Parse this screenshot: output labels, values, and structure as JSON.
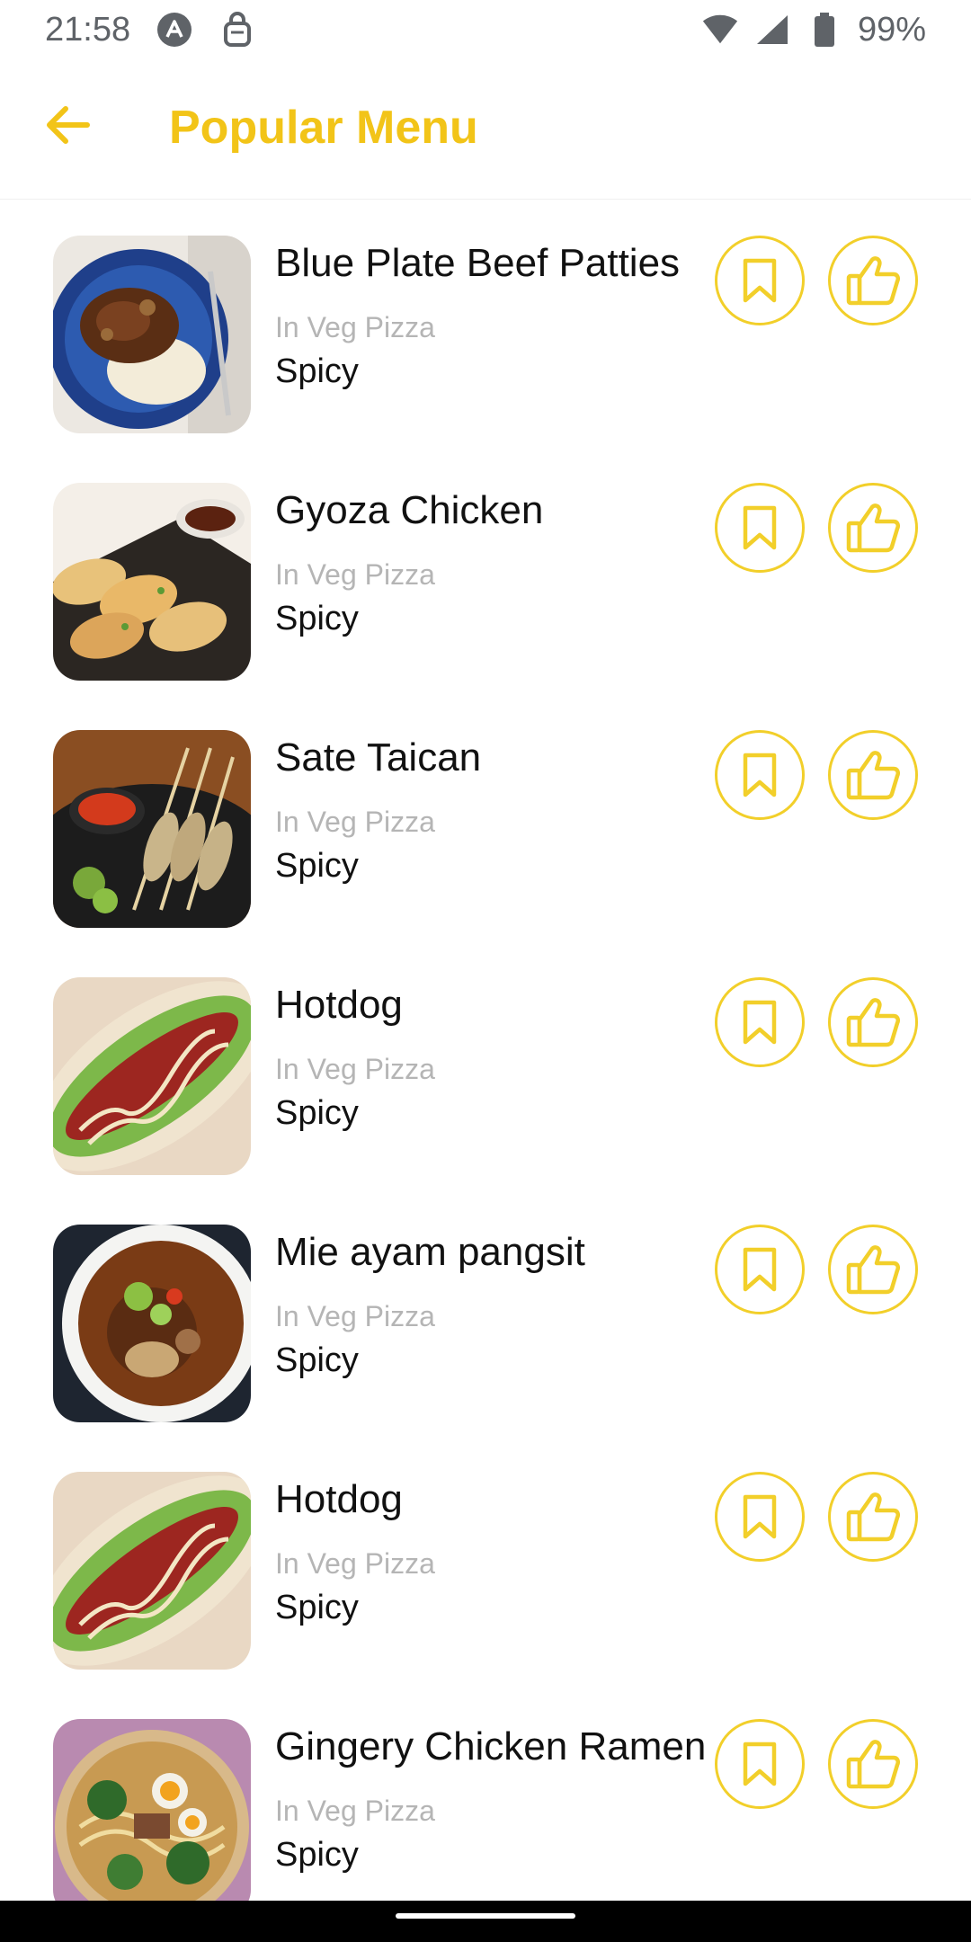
{
  "status_bar": {
    "time": "21:58",
    "battery": "99%"
  },
  "header": {
    "title": "Popular Menu",
    "back_icon": "arrow-left-icon"
  },
  "colors": {
    "accent": "#f2c418",
    "button_border": "#f2cf2a",
    "muted_text": "#b5b5b5"
  },
  "menu": {
    "items": [
      {
        "name": "Blue Plate Beef Patties",
        "category": "In Veg Pizza",
        "tag": "Spicy"
      },
      {
        "name": "Gyoza Chicken",
        "category": "In Veg Pizza",
        "tag": "Spicy"
      },
      {
        "name": "Sate Taican",
        "category": "In Veg Pizza",
        "tag": "Spicy"
      },
      {
        "name": "Hotdog",
        "category": "In Veg Pizza",
        "tag": "Spicy"
      },
      {
        "name": "Mie ayam pangsit",
        "category": "In Veg Pizza",
        "tag": "Spicy"
      },
      {
        "name": "Hotdog",
        "category": "In Veg Pizza",
        "tag": "Spicy"
      },
      {
        "name": "Gingery Chicken Ramen",
        "category": "In Veg Pizza",
        "tag": "Spicy"
      }
    ]
  }
}
